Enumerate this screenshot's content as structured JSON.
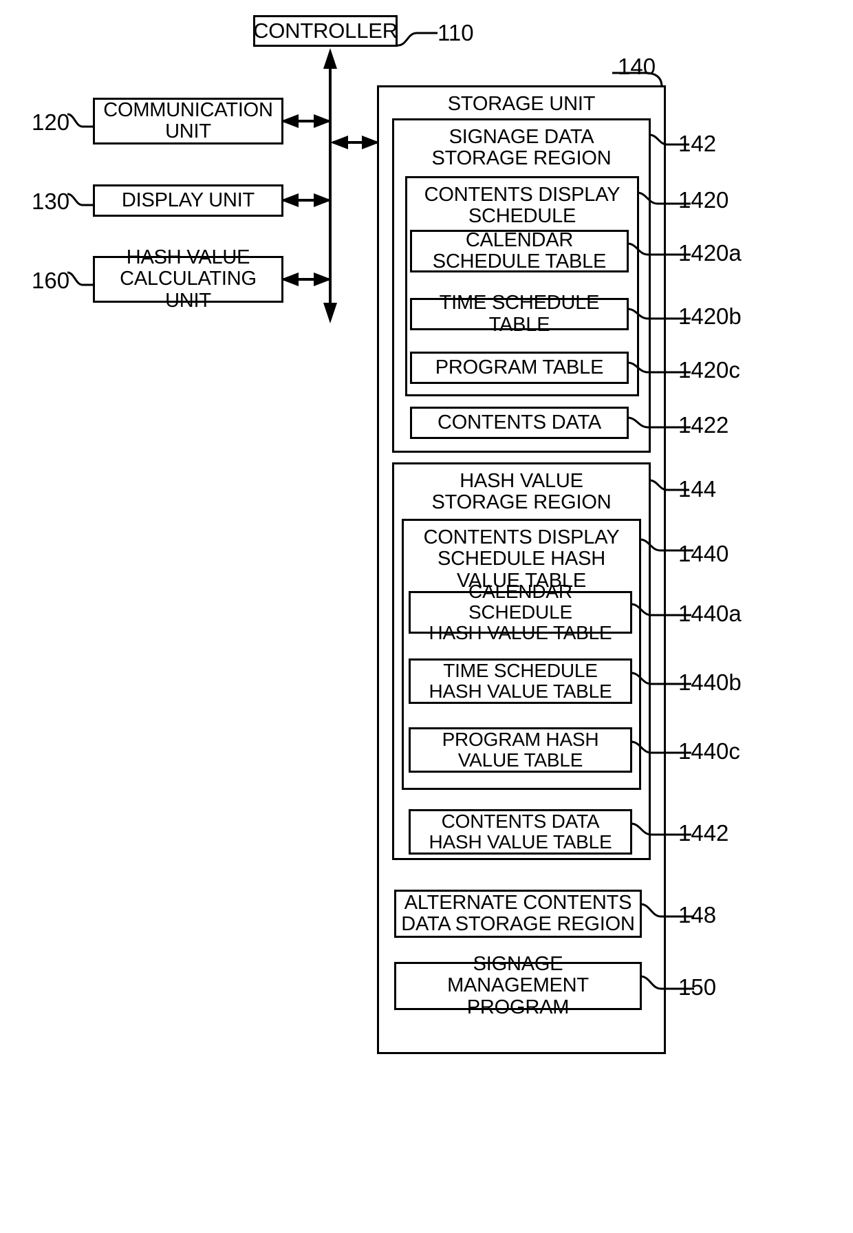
{
  "figure": {
    "type": "patent-block-diagram",
    "blocks": {
      "controller": {
        "label": "CONTROLLER",
        "ref": "110"
      },
      "communication_unit": {
        "label": "COMMUNICATION\nUNIT",
        "ref": "120"
      },
      "display_unit": {
        "label": "DISPLAY UNIT",
        "ref": "130"
      },
      "hash_value_calculating_unit": {
        "label": "HASH VALUE\nCALCULATING UNIT",
        "ref": "160"
      },
      "storage_unit": {
        "label": "STORAGE UNIT",
        "ref": "140"
      },
      "signage_data_storage_region": {
        "label": "SIGNAGE DATA\nSTORAGE REGION",
        "ref": "142"
      },
      "contents_display_schedule": {
        "label": "CONTENTS DISPLAY\nSCHEDULE",
        "ref": "1420"
      },
      "calendar_schedule_table": {
        "label": "CALENDAR\nSCHEDULE TABLE",
        "ref": "1420a"
      },
      "time_schedule_table": {
        "label": "TIME SCHEDULE TABLE",
        "ref": "1420b"
      },
      "program_table": {
        "label": "PROGRAM TABLE",
        "ref": "1420c"
      },
      "contents_data": {
        "label": "CONTENTS DATA",
        "ref": "1422"
      },
      "hash_value_storage_region": {
        "label": "HASH VALUE\nSTORAGE REGION",
        "ref": "144"
      },
      "contents_display_schedule_hash_value_table": {
        "label": "CONTENTS DISPLAY\nSCHEDULE HASH\nVALUE TABLE",
        "ref": "1440"
      },
      "calendar_schedule_hash_value_table": {
        "label": "CALENDAR SCHEDULE\nHASH VALUE TABLE",
        "ref": "1440a"
      },
      "time_schedule_hash_value_table": {
        "label": "TIME SCHEDULE\nHASH VALUE TABLE",
        "ref": "1440b"
      },
      "program_hash_value_table": {
        "label": "PROGRAM HASH\nVALUE TABLE",
        "ref": "1440c"
      },
      "contents_data_hash_value_table": {
        "label": "CONTENTS DATA\nHASH VALUE TABLE",
        "ref": "1442"
      },
      "alternate_contents_data_storage_region": {
        "label": "ALTERNATE CONTENTS\nDATA STORAGE REGION",
        "ref": "148"
      },
      "signage_management_program": {
        "label": "SIGNAGE MANAGEMENT\nPROGRAM",
        "ref": "150"
      }
    }
  }
}
